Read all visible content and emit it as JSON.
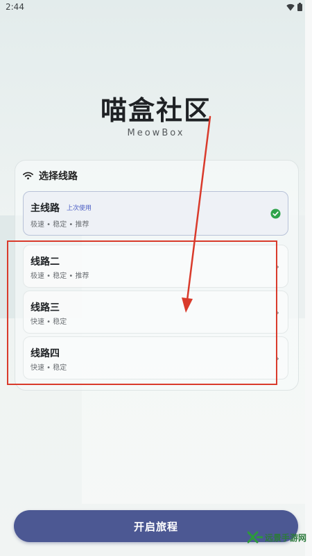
{
  "status_bar": {
    "time": "2:44",
    "icons": [
      "wifi-icon",
      "battery-icon"
    ]
  },
  "app": {
    "title": "喵盒社区",
    "subtitle": "MeowBox"
  },
  "route_panel": {
    "header_icon": "wifi-icon",
    "title": "选择线路",
    "routes": [
      {
        "name": "主线路",
        "badge": "上次使用",
        "desc": "极速 • 稳定 • 推荐",
        "selected": true,
        "indicator": "check-circle-icon"
      },
      {
        "name": "线路二",
        "desc": "极速 • 稳定 • 推荐",
        "selected": false,
        "indicator": "chevron-right-icon"
      },
      {
        "name": "线路三",
        "desc": "快速 • 稳定",
        "selected": false,
        "indicator": "chevron-right-icon"
      },
      {
        "name": "线路四",
        "desc": "快速 • 稳定",
        "selected": false,
        "indicator": "chevron-right-icon"
      }
    ]
  },
  "start_button": {
    "label": "开启旅程"
  },
  "watermark": {
    "text": "远景手游网"
  },
  "colors": {
    "accent": "#4c5893",
    "badge": "#4a5dc4",
    "check": "#2ea34a",
    "annotation": "#d93a2b"
  }
}
